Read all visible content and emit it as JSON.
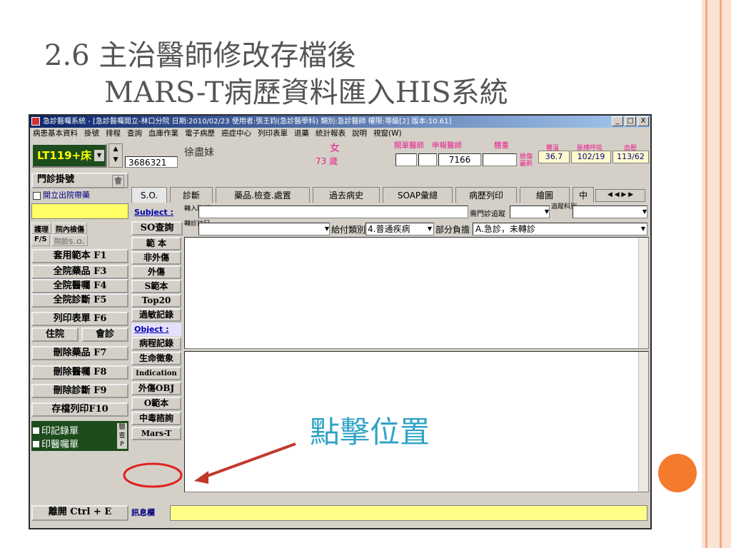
{
  "slide": {
    "title_line1": "2.6  主治醫師修改存檔後",
    "title_line2": "MARS-T病歷資料匯入HIS系統"
  },
  "window": {
    "title": "急診醫囑系統 - [急診醫囑閱立-林口分院 日期:2010/02/23 使用者:張王鈞(急診醫學科) 類別:急診醫師 權限:等級[2] 版本:10.61]",
    "controls": [
      "_",
      "□",
      "X"
    ]
  },
  "menu": [
    "病患基本資料",
    "掛號",
    "排程",
    "查詢",
    "血庫作業",
    "電子病歷",
    "癌症中心",
    "列印表單",
    "退藥",
    "統計報表",
    "說明",
    "視窗(W)"
  ],
  "patient": {
    "bed": "LT119+床",
    "chart_no": "3686321",
    "name": "徐盡妹",
    "sex": "女",
    "age": "73 歲",
    "open_doctor_label": "開單醫師",
    "report_doctor_label": "申報醫師",
    "report_doctor_value": "7166",
    "weight_label": "體重",
    "triage_label": "檢傷最新",
    "vitals": [
      {
        "label": "體溫",
        "value": "36.7"
      },
      {
        "label": "脈搏呼吸",
        "value": "102/19"
      },
      {
        "label": "血壓",
        "value": "113/62"
      }
    ]
  },
  "left_panel": {
    "registration": "門診掛號",
    "registration_ico": "會",
    "discharge_checkbox": "開立出院帶藥",
    "care": "護理",
    "inhouse_check": "院內檢傷",
    "fs": "F/S",
    "prev_so": "院前S.O.",
    "buttons": [
      "套用範本 F1",
      "全院藥品 F3",
      "全院醫囑 F4",
      "全院診斷 F5",
      "列印表單 F6",
      "住院",
      "會診",
      "刪除藥品 F7",
      "刪除醫囑 F8",
      "刪除診斷 F9",
      "存檔列印F10"
    ],
    "print_record": "印記錄單",
    "print_order": "印醫囑單",
    "side_small": [
      "驗",
      "查",
      "P"
    ],
    "exit": "離開 Ctrl + E"
  },
  "tabs": [
    "S.O.",
    "診斷",
    "藥品.檢查.處置",
    "過去病史",
    "SOAP彙總",
    "病歷列印",
    "繪圖",
    "中"
  ],
  "form": {
    "subject_label": "Subject :",
    "so_query": "SO查詢",
    "transfer_hospital_label": "轉入院所",
    "need_outpatient_label": "需門診追蹤",
    "track_dept_label": "追蹤科別",
    "referral_note_label": "轉診註記",
    "payment_type_label": "給付類別",
    "payment_type_value": "4.普通疾病",
    "copay_label": "部分負擔",
    "copay_value": "A.急診，未轉診"
  },
  "mid_panel": {
    "subject_buttons": [
      "範 本",
      "非外傷",
      "外傷",
      "S範本",
      "Top20",
      "過敏記錄"
    ],
    "object_label": "Object :",
    "object_buttons": [
      "病程記錄",
      "生命徵象",
      "Indication",
      "外傷OBJ",
      "O範本",
      "中毒諮詢",
      "Mars-T"
    ]
  },
  "message_bar_label": "訊息欄",
  "annotation": "點擊位置",
  "colors": {
    "accent_orange": "#f47a2e",
    "annotation_blue": "#2fa3c6",
    "bed_bg": "#1d4c1d",
    "pink_label": "#e81e8c",
    "highlight_red": "#e02020"
  }
}
